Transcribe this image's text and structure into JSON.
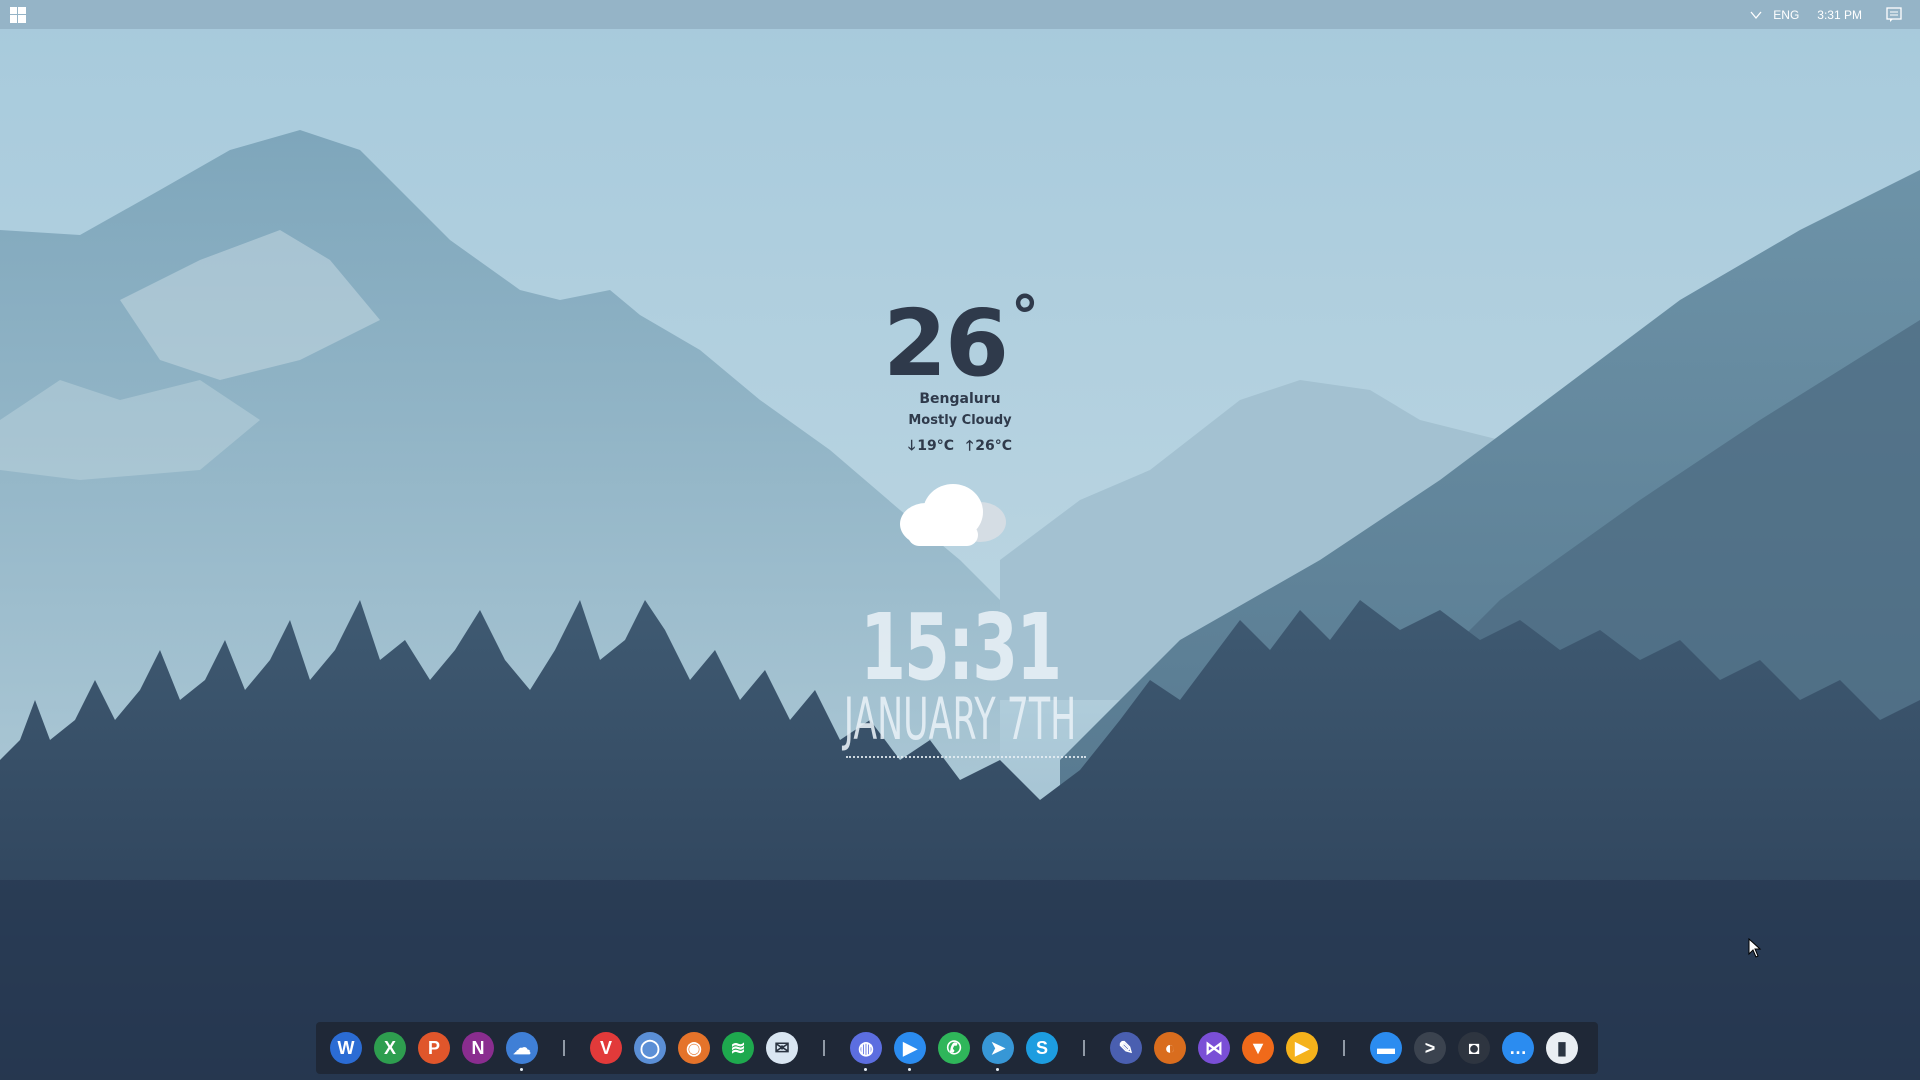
{
  "tray": {
    "language": "ENG",
    "time": "3:31 PM"
  },
  "weather": {
    "temperature": "26",
    "degree_symbol": "°",
    "city": "Bengaluru",
    "condition": "Mostly Cloudy",
    "low": "19°C",
    "high": "26°C",
    "low_arrow": "🡓",
    "high_arrow": "🡑"
  },
  "clock": {
    "time": "15:31",
    "date": "JANUARY 7TH"
  },
  "dock": {
    "groups": [
      [
        "Word",
        "Excel",
        "PowerPoint",
        "OneNote",
        "OneDrive"
      ],
      [
        "Vivaldi",
        "Chromium",
        "Firefox",
        "Spotify",
        "Mail"
      ],
      [
        "Discord",
        "Zoom",
        "WhatsApp",
        "Telegram",
        "Skype"
      ],
      [
        "Pen",
        "Blender",
        "Visual Studio",
        "Brave",
        "Player"
      ],
      [
        "Files",
        "Terminal",
        "Toggle",
        "More",
        "Recycle Bin"
      ]
    ],
    "colors": {
      "word": "#2b6cd4",
      "excel": "#2e9e4f",
      "powerpoint": "#e0562b",
      "onenote": "#8a2d8f",
      "onedrive": "#3f7fd6",
      "vivaldi": "#e23a3a",
      "chromium": "#5b8fd6",
      "firefox": "#e5732a",
      "spotify": "#1ea94e",
      "mail": "#d9e6f2",
      "discord": "#5c6ee0",
      "zoom": "#2b8cf0",
      "whatsapp": "#2fb65a",
      "telegram": "#3797d6",
      "skype": "#1d9de0",
      "pen": "#4a5fb0",
      "blender": "#d96d1e",
      "visualstudio": "#7a4fd6",
      "brave": "#f06a1a",
      "player": "#f5b21b",
      "files": "#2b8cf0",
      "terminal": "#3b434f",
      "toggle": "#2e3540",
      "more": "#2b8cf0",
      "trash": "#e9eef3"
    }
  }
}
